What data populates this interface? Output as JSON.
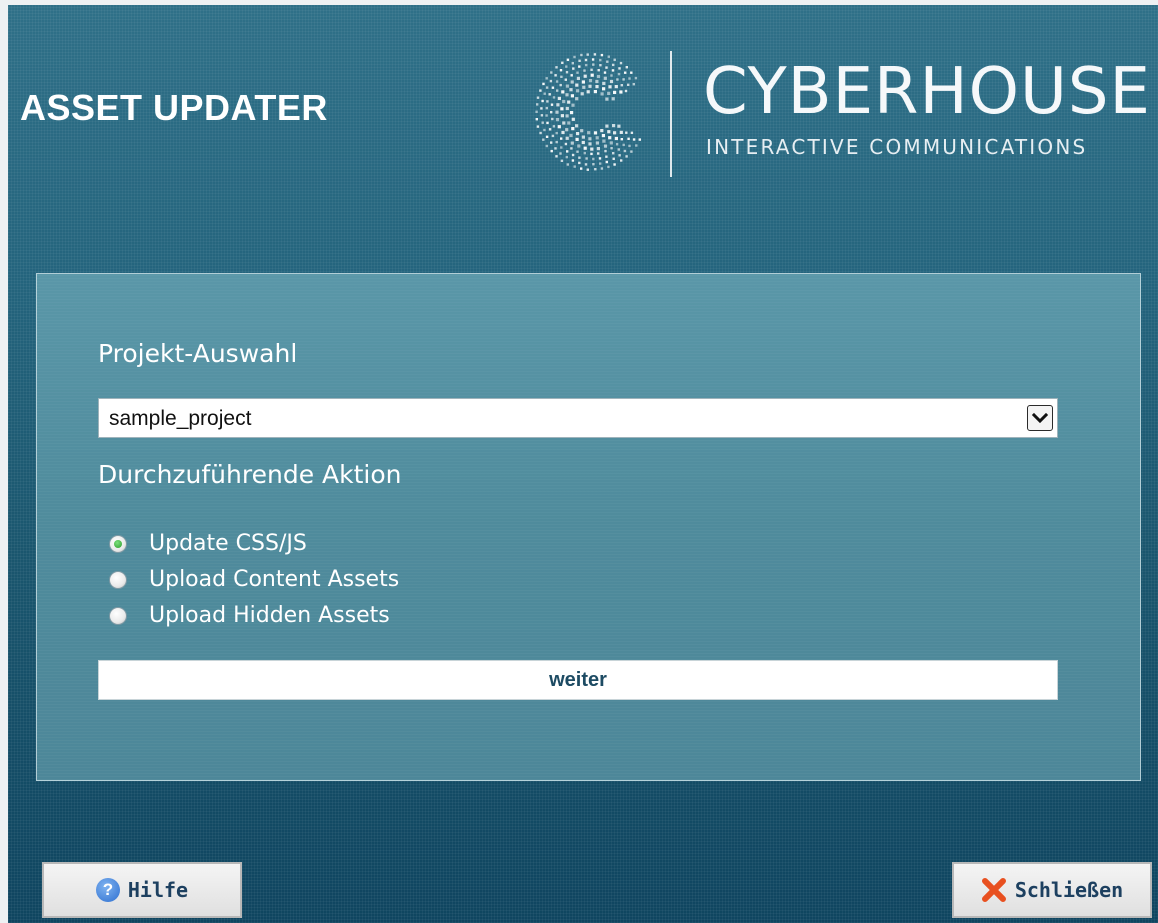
{
  "header": {
    "app_title": "ASSET UPDATER",
    "logo": {
      "name": "CYBERHOUSE",
      "tagline": "INTERACTIVE COMMUNICATIONS"
    }
  },
  "project_section": {
    "title": "Projekt-Auswahl",
    "selected_project": "sample_project"
  },
  "action_section": {
    "title": "Durchzuführende Aktion",
    "options": [
      {
        "label": "Update CSS/JS",
        "checked": true
      },
      {
        "label": "Upload Content Assets",
        "checked": false
      },
      {
        "label": "Upload Hidden Assets",
        "checked": false
      }
    ]
  },
  "next_button": {
    "label": "weiter"
  },
  "footer": {
    "help_label": "Hilfe",
    "close_label": "Schließen"
  },
  "colors": {
    "background": "#24647d",
    "panel": "#4f8b9c",
    "button_text": "#1d4b63",
    "radio_checked": "#2e9c2e",
    "close_icon": "#e85020",
    "help_icon": "#2e6fd0"
  },
  "icons": [
    "cyberhouse-logo-icon",
    "chevron-down-icon",
    "help-icon",
    "close-icon"
  ]
}
